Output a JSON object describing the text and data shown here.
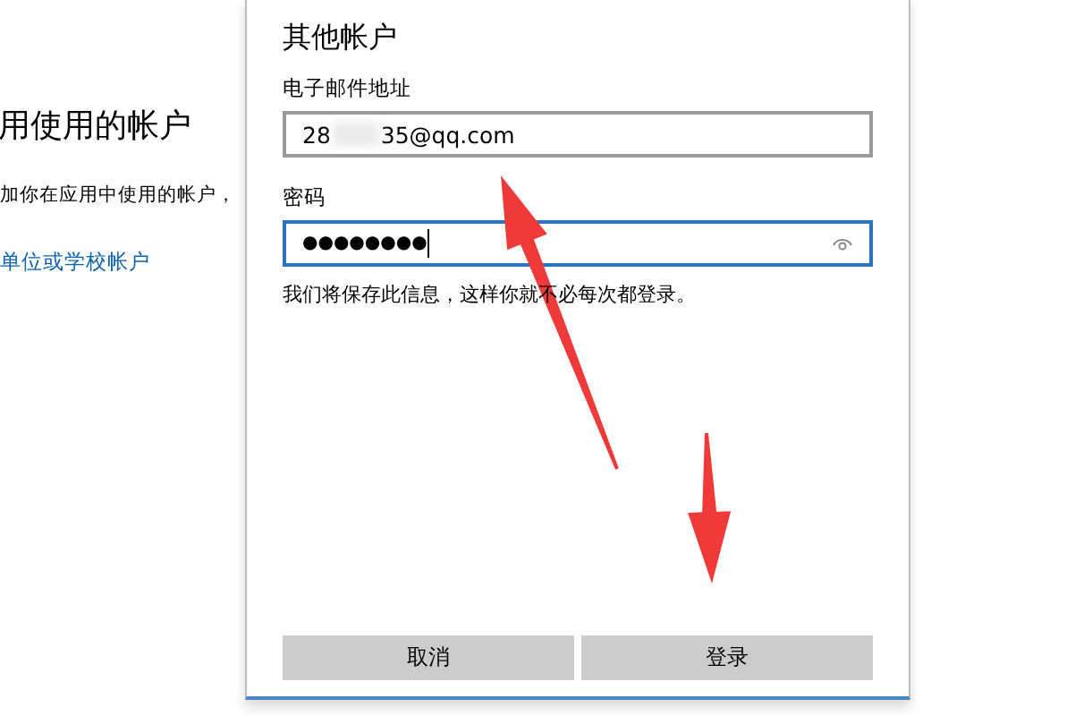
{
  "background": {
    "heading": "用使用的帐户",
    "description": "加你在应用中使用的帐户，",
    "link": "单位或学校帐户"
  },
  "dialog": {
    "title": "其他帐户",
    "email": {
      "label": "电子邮件地址",
      "value_start": "28",
      "value_end": "35@qq.com",
      "blurred": true
    },
    "password": {
      "label": "密码",
      "value": "●●●●●●●●",
      "focused": true
    },
    "note": "我们将保存此信息，这样你就不必每次都登录。",
    "buttons": [
      "取消",
      "登录"
    ]
  },
  "annotations": [
    {
      "kind": "arrow"
    },
    {
      "kind": "arrow"
    }
  ]
}
